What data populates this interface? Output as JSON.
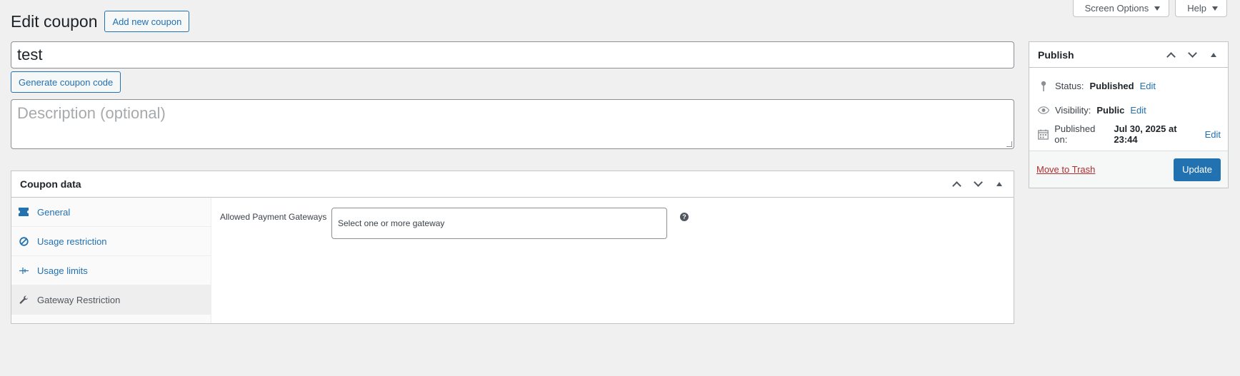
{
  "screen_meta": {
    "screen_options": "Screen Options",
    "help": "Help"
  },
  "header": {
    "title": "Edit coupon",
    "add_new": "Add new coupon"
  },
  "coupon": {
    "title_value": "test",
    "generate_code": "Generate coupon code",
    "description_placeholder": "Description (optional)"
  },
  "coupon_data": {
    "title": "Coupon data",
    "tabs": [
      {
        "label": "General",
        "icon": "ticket-icon"
      },
      {
        "label": "Usage restriction",
        "icon": "block-icon"
      },
      {
        "label": "Usage limits",
        "icon": "limits-icon"
      },
      {
        "label": "Gateway Restriction",
        "icon": "wrench-icon"
      }
    ],
    "gateway_label": "Allowed Payment Gateways",
    "gateway_placeholder": "Select one or more gateway",
    "help_mark": "?"
  },
  "publish": {
    "title": "Publish",
    "status_label": "Status:",
    "status_value": "Published",
    "visibility_label": "Visibility:",
    "visibility_value": "Public",
    "published_label": "Published on:",
    "published_value": "Jul 30, 2025 at 23:44",
    "edit": "Edit",
    "trash": "Move to Trash",
    "update": "Update"
  }
}
